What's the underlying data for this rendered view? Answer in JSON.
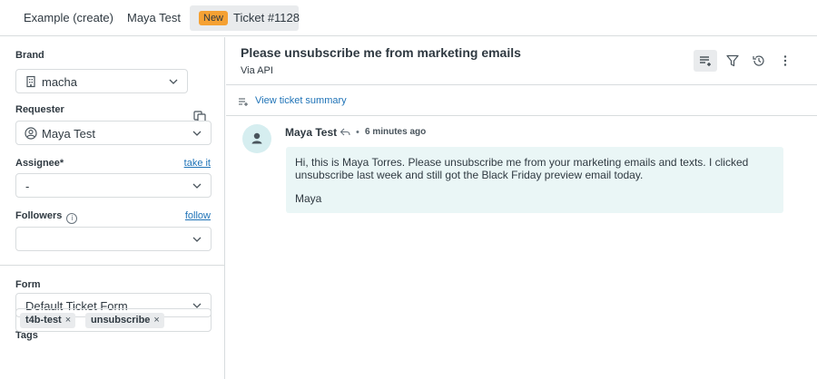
{
  "tabs": [
    {
      "label": "Example (create)"
    },
    {
      "label": "Maya Test"
    },
    {
      "badge": "New",
      "label": "Ticket #1128"
    }
  ],
  "sidebar": {
    "brand": {
      "label": "Brand",
      "value": "macha"
    },
    "requester": {
      "label": "Requester",
      "value": "Maya Test"
    },
    "assignee": {
      "label": "Assignee*",
      "value": "-",
      "link": "take it"
    },
    "followers": {
      "label": "Followers",
      "value": "",
      "link": "follow"
    },
    "form": {
      "label": "Form",
      "value": "Default Ticket Form"
    },
    "tags": {
      "label": "Tags",
      "items": [
        "t4b-test",
        "unsubscribe"
      ],
      "remove_glyph": "×"
    }
  },
  "ticket": {
    "subject": "Please unsubscribe me from marketing emails",
    "via": "Via API",
    "summary_link": "View ticket summary"
  },
  "message": {
    "author": "Maya Test",
    "separator": "•",
    "time": "6 minutes ago",
    "body": "Hi, this is Maya Torres. Please unsubscribe me from your marketing emails and texts. I clicked unsubscribe last week and still got the Black Friday preview email today.",
    "signature": "Maya"
  },
  "colors": {
    "accent_link": "#1f73b7",
    "badge_new": "#f5a133",
    "bubble_bg": "#eaf6f6",
    "avatar_bg": "#d6eef0",
    "border": "#d8dcde"
  },
  "icons": {
    "brand": "building-icon",
    "requester": "user-circle-icon",
    "copy": "copy-icon",
    "toolbar": [
      "conversation-filter-icon",
      "filter-icon",
      "history-icon",
      "more-vertical-icon"
    ],
    "summary": "summary-list-icon",
    "avatar": "user-icon",
    "reply": "reply-icon"
  }
}
